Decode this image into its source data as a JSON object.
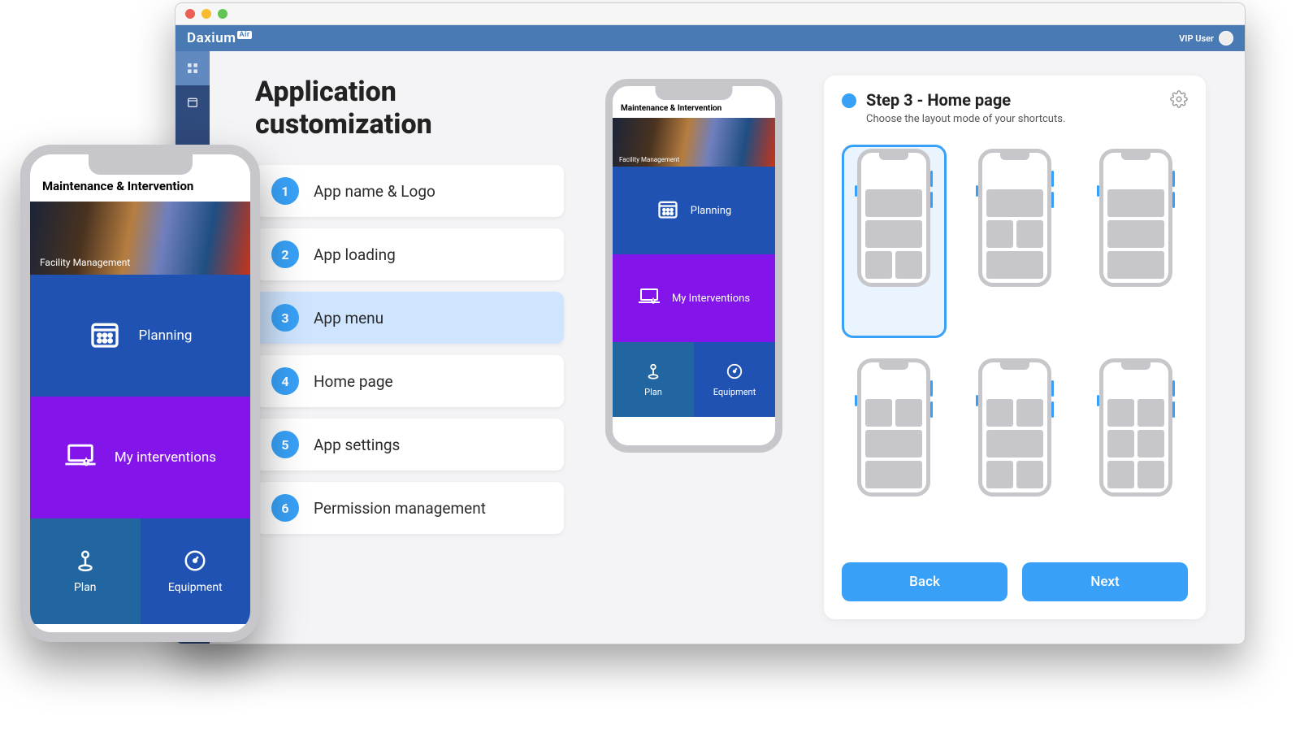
{
  "brand": "Daxium",
  "brand_suffix": "Air",
  "user_label": "VIP User",
  "page_title": "Application customization",
  "steps": [
    {
      "num": "1",
      "label": "App name & Logo"
    },
    {
      "num": "2",
      "label": "App loading"
    },
    {
      "num": "3",
      "label": "App menu"
    },
    {
      "num": "4",
      "label": "Home page"
    },
    {
      "num": "5",
      "label": "App settings"
    },
    {
      "num": "6",
      "label": "Permission management"
    }
  ],
  "active_step_index": 2,
  "wizard": {
    "title": "Step 3 - Home page",
    "subtitle": "Choose the layout mode of your shortcuts.",
    "back_label": "Back",
    "next_label": "Next",
    "selected_layout_index": 0
  },
  "preview_phone": {
    "app_title": "Maintenance & Intervention",
    "banner_label": "Facility Management",
    "tiles": [
      {
        "label": "Planning",
        "icon": "calendar",
        "bg": "#1f52b2"
      },
      {
        "label": "My Interventions",
        "icon": "laptop-warn",
        "bg": "#8314ea"
      }
    ],
    "half_tiles": [
      {
        "label": "Plan",
        "icon": "pin",
        "bg": "#2266a1"
      },
      {
        "label": "Equipment",
        "icon": "gauge",
        "bg": "#1f52b2"
      }
    ]
  },
  "large_phone": {
    "app_title": "Maintenance & Intervention",
    "banner_label": "Facility Management",
    "tiles": [
      {
        "label": "Planning",
        "icon": "calendar",
        "bg": "#1f52b2"
      },
      {
        "label": "My interventions",
        "icon": "laptop-warn",
        "bg": "#8314ea"
      }
    ],
    "half_tiles": [
      {
        "label": "Plan",
        "icon": "pin",
        "bg": "#2266a1"
      },
      {
        "label": "Equipment",
        "icon": "gauge",
        "bg": "#1f52b2"
      }
    ]
  },
  "layouts": [
    {
      "rows": [
        [
          1
        ],
        [
          1
        ],
        [
          2
        ]
      ]
    },
    {
      "rows": [
        [
          1
        ],
        [
          2
        ],
        [
          1
        ]
      ]
    },
    {
      "rows": [
        [
          1
        ],
        [
          1
        ],
        [
          1
        ]
      ]
    },
    {
      "rows": [
        [
          2
        ],
        [
          1
        ],
        [
          1
        ]
      ]
    },
    {
      "rows": [
        [
          2
        ],
        [
          1
        ],
        [
          2
        ]
      ]
    },
    {
      "rows": [
        [
          2
        ],
        [
          2
        ],
        [
          2
        ]
      ]
    }
  ]
}
